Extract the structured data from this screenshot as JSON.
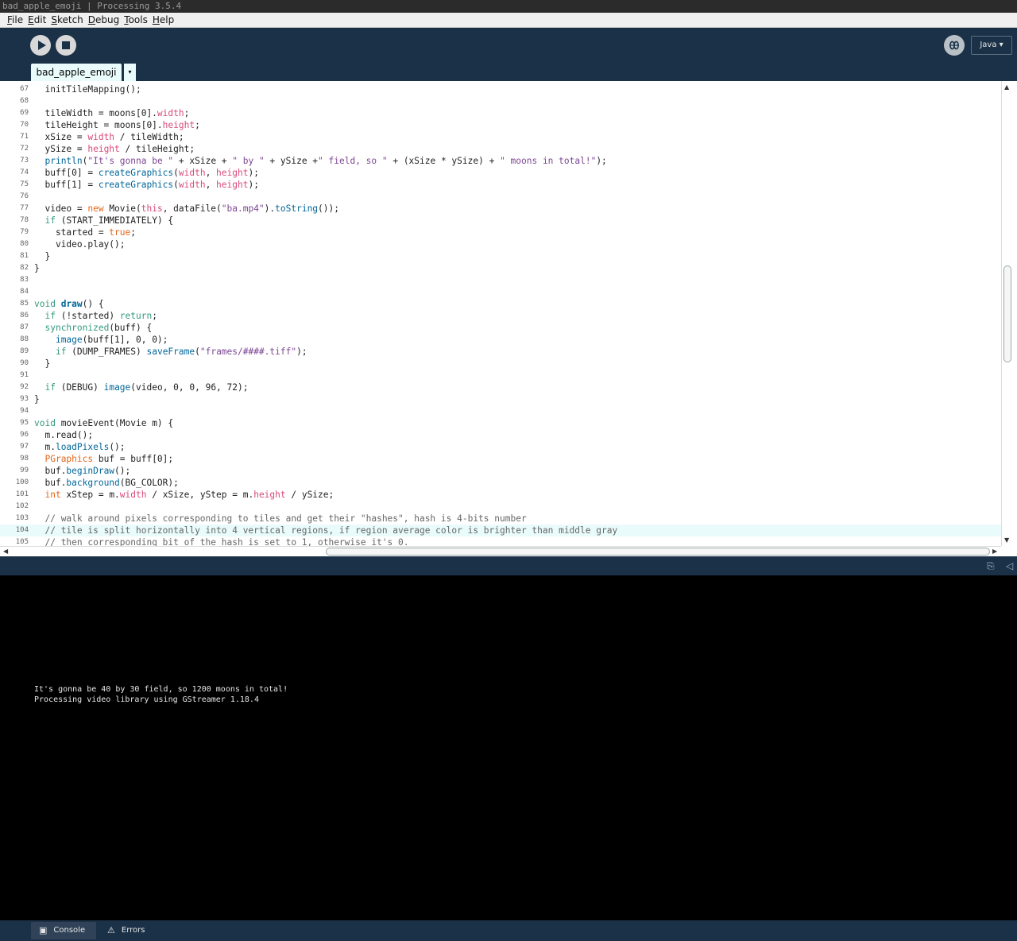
{
  "window": {
    "title": "bad_apple_emoji | Processing 3.5.4"
  },
  "menu": [
    {
      "label_u": "F",
      "label_rest": "ile"
    },
    {
      "label_u": "E",
      "label_rest": "dit"
    },
    {
      "label_u": "S",
      "label_rest": "ketch"
    },
    {
      "label_u": "D",
      "label_rest": "ebug"
    },
    {
      "label_u": "T",
      "label_rest": "ools"
    },
    {
      "label_u": "H",
      "label_rest": "elp"
    }
  ],
  "toolbar": {
    "mode_label": "Java ▾"
  },
  "tab": {
    "name": "bad_apple_emoji",
    "menu_glyph": "▾"
  },
  "code": {
    "highlight_line": 104,
    "lines": [
      {
        "n": 67,
        "html": "  initTileMapping();"
      },
      {
        "n": 68,
        "html": ""
      },
      {
        "n": 69,
        "html": "  tileWidth = moons[0].<span class=\"var\">width</span>;"
      },
      {
        "n": 70,
        "html": "  tileHeight = moons[0].<span class=\"var\">height</span>;"
      },
      {
        "n": 71,
        "html": "  xSize = <span class=\"var\">width</span> / tileWidth;"
      },
      {
        "n": 72,
        "html": "  ySize = <span class=\"var\">height</span> / tileHeight;"
      },
      {
        "n": 73,
        "html": "  <span class=\"fn\">println</span>(<span class=\"str\">\"It's gonna be \"</span> + xSize + <span class=\"str\">\" by \"</span> + ySize +<span class=\"str\">\" field, so \"</span> + (xSize * ySize) + <span class=\"str\">\" moons in total!\"</span>);"
      },
      {
        "n": 74,
        "html": "  buff[0] = <span class=\"fn\">createGraphics</span>(<span class=\"var\">width</span>, <span class=\"var\">height</span>);"
      },
      {
        "n": 75,
        "html": "  buff[1] = <span class=\"fn\">createGraphics</span>(<span class=\"var\">width</span>, <span class=\"var\">height</span>);"
      },
      {
        "n": 76,
        "html": ""
      },
      {
        "n": 77,
        "html": "  video = <span class=\"kw2\">new</span> Movie(<span class=\"var\">this</span>, dataFile(<span class=\"str\">\"ba.mp4\"</span>).<span class=\"fn\">toString</span>());"
      },
      {
        "n": 78,
        "html": "  <span class=\"kw\">if</span> (START_IMMEDIATELY) {"
      },
      {
        "n": 79,
        "html": "    started = <span class=\"kw2\">true</span>;"
      },
      {
        "n": 80,
        "html": "    video.play();"
      },
      {
        "n": 81,
        "html": "  }"
      },
      {
        "n": 82,
        "html": "}"
      },
      {
        "n": 83,
        "html": ""
      },
      {
        "n": 84,
        "html": ""
      },
      {
        "n": 85,
        "html": "<span class=\"kw\">void</span> <span class=\"fnb\">draw</span>() {"
      },
      {
        "n": 86,
        "html": "  <span class=\"kw\">if</span> (!started) <span class=\"kw\">return</span>;"
      },
      {
        "n": 87,
        "html": "  <span class=\"kw\">synchronized</span>(buff) {"
      },
      {
        "n": 88,
        "html": "    <span class=\"fn\">image</span>(buff[1], 0, 0);"
      },
      {
        "n": 89,
        "html": "    <span class=\"kw\">if</span> (DUMP_FRAMES) <span class=\"fn\">saveFrame</span>(<span class=\"str\">\"frames/####.tiff\"</span>);"
      },
      {
        "n": 90,
        "html": "  }"
      },
      {
        "n": 91,
        "html": ""
      },
      {
        "n": 92,
        "html": "  <span class=\"kw\">if</span> (DEBUG) <span class=\"fn\">image</span>(video, 0, 0, 96, 72);"
      },
      {
        "n": 93,
        "html": "}"
      },
      {
        "n": 94,
        "html": ""
      },
      {
        "n": 95,
        "html": "<span class=\"kw\">void</span> movieEvent(Movie m) {"
      },
      {
        "n": 96,
        "html": "  m.read();"
      },
      {
        "n": 97,
        "html": "  m.<span class=\"fn\">loadPixels</span>();"
      },
      {
        "n": 98,
        "html": "  <span class=\"kw2\">PGraphics</span> buf = buff[0];"
      },
      {
        "n": 99,
        "html": "  buf.<span class=\"fn\">beginDraw</span>();"
      },
      {
        "n": 100,
        "html": "  buf.<span class=\"fn\">background</span>(BG_COLOR);"
      },
      {
        "n": 101,
        "html": "  <span class=\"kw2\">int</span> xStep = m.<span class=\"var\">width</span> / xSize, yStep = m.<span class=\"var\">height</span> / ySize;"
      },
      {
        "n": 102,
        "html": ""
      },
      {
        "n": 103,
        "html": "  <span class=\"cm\">// walk around pixels corresponding to tiles and get their \"hashes\", hash is 4-bits number</span>"
      },
      {
        "n": 104,
        "html": "  <span class=\"cm\">// tile is split horizontally into 4 vertical regions, if region average color is brighter than middle gray</span>"
      },
      {
        "n": 105,
        "html": "  <span class=\"cm\">// then corresponding bit of the hash is set to 1, otherwise it's 0.</span>"
      }
    ]
  },
  "console": {
    "lines": [
      "It's gonna be 40 by 30 field, so 1200 moons in total!",
      "Processing video library using GStreamer 1.18.4"
    ]
  },
  "footer": {
    "console_label": "Console",
    "errors_label": "Errors"
  },
  "icons": {
    "play": "play-icon",
    "stop": "stop-icon",
    "debug": "bug-icon",
    "console": "terminal-icon",
    "errors": "warning-icon"
  }
}
